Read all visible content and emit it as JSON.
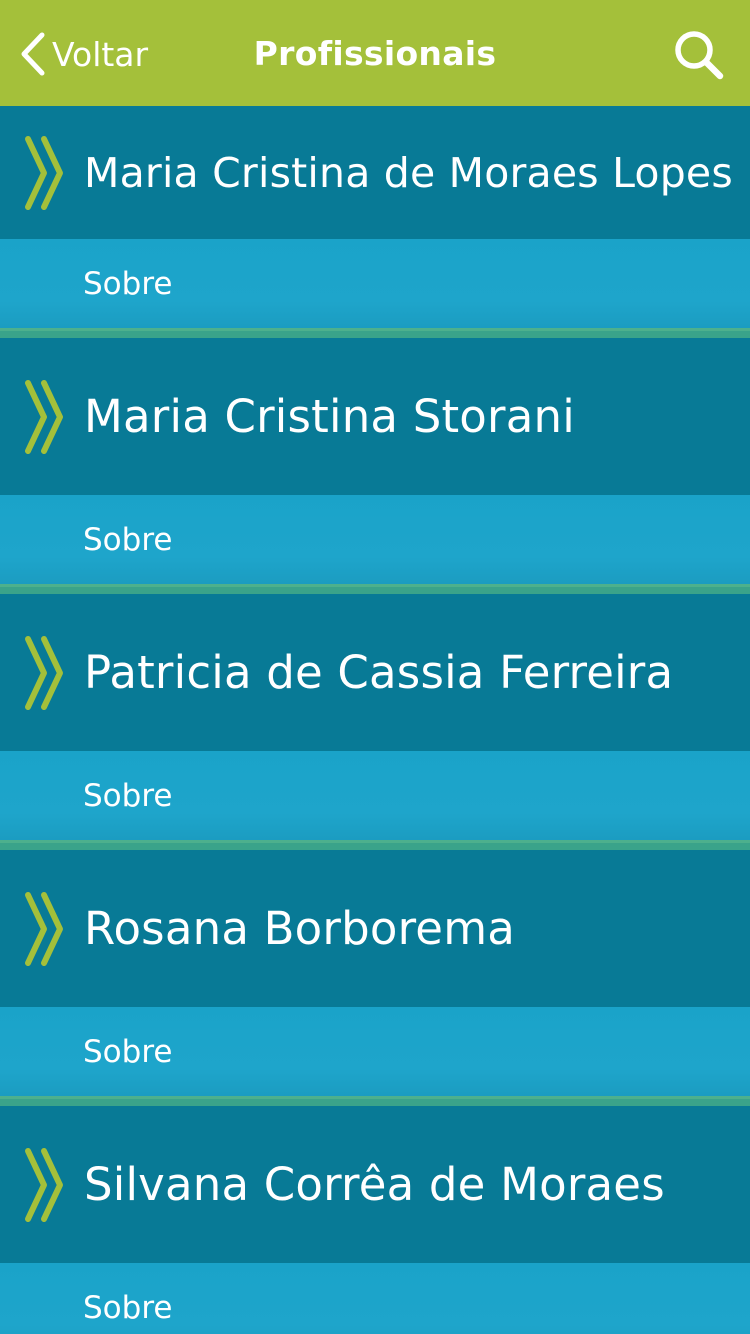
{
  "navbar": {
    "back_label": "Voltar",
    "title": "Profissionais",
    "back_icon": "chevron-left-icon",
    "search_icon": "search-icon"
  },
  "colors": {
    "navbar_bg": "#a4c03a",
    "item_head_bg": "#087a96",
    "item_sub_bg": "#1ea5cb",
    "divider": "#3aa38a",
    "chevron": "#a4c03a",
    "text": "#ffffff"
  },
  "professionals": [
    {
      "name": "Maria Cristina de Moraes Lopes",
      "sub_label": "Sobre"
    },
    {
      "name": "Maria Cristina Storani",
      "sub_label": "Sobre"
    },
    {
      "name": "Patricia de Cassia Ferreira",
      "sub_label": "Sobre"
    },
    {
      "name": "Rosana Borborema",
      "sub_label": "Sobre"
    },
    {
      "name": "Silvana Corrêa de Moraes",
      "sub_label": "Sobre"
    }
  ]
}
